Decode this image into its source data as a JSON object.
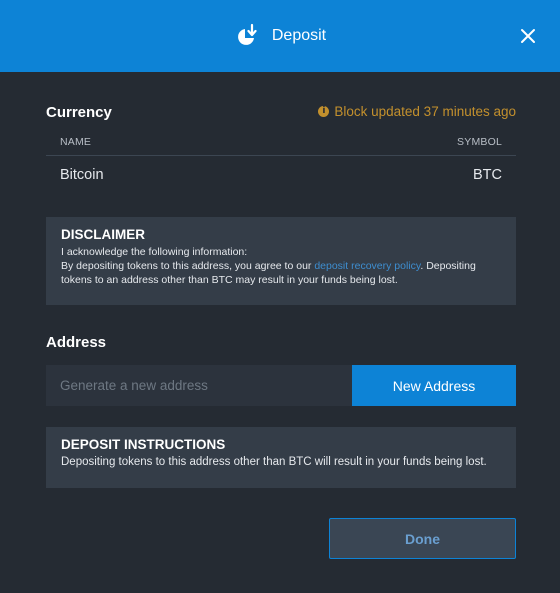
{
  "header": {
    "title": "Deposit",
    "icon": "deposit-icon",
    "close_icon": "close-icon",
    "bg_color": "#0d83d6"
  },
  "currency": {
    "title": "Currency",
    "block_updated": "Block updated 37 minutes ago",
    "block_updated_icon": "info-icon",
    "columns": [
      "NAME",
      "SYMBOL"
    ],
    "rows": [
      {
        "name": "Bitcoin",
        "symbol": "BTC"
      }
    ]
  },
  "disclaimer": {
    "title": "DISCLAIMER",
    "line1": "I acknowledge the following information:",
    "text_before_link": "By depositing tokens to this address, you agree to our ",
    "link_text": "deposit recovery policy",
    "text_after_link": ". Depositing tokens to an address other than BTC may result in your funds being lost."
  },
  "address": {
    "title": "Address",
    "placeholder": "Generate a new address",
    "value": "",
    "new_address_label": "New Address"
  },
  "instructions": {
    "title": "DEPOSIT INSTRUCTIONS",
    "text": "Depositing tokens to this address other than BTC will result in your funds being lost."
  },
  "footer": {
    "done_label": "Done"
  }
}
